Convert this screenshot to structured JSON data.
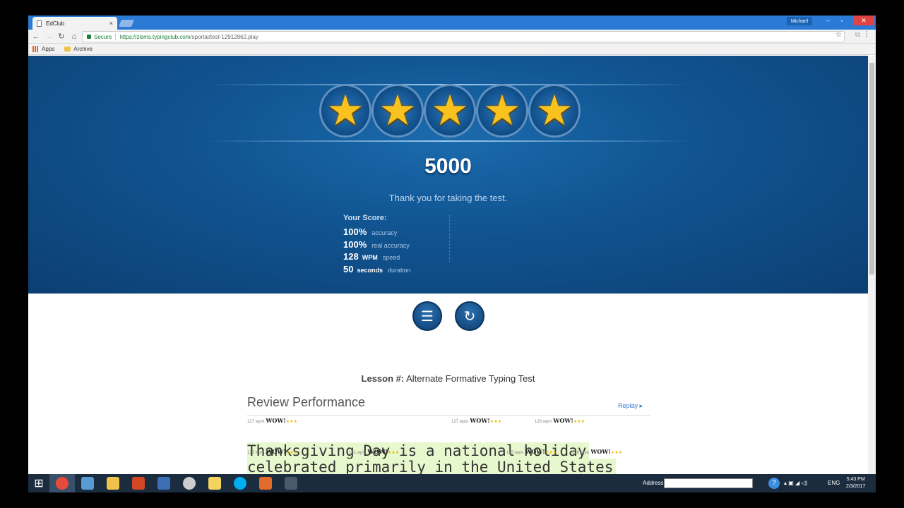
{
  "browser": {
    "tab_title": "EdClub",
    "tab_close": "×",
    "profile_name": "Michael",
    "win_minimize": "–",
    "win_maximize": "▫",
    "win_close": "✕",
    "secure_label": "Secure",
    "url_host": "https://zisms.typingclub.com",
    "url_path": "/sportal/test-12912862.play",
    "bookmarks": [
      "Apps",
      "Archive"
    ]
  },
  "result": {
    "stars_earned": 5,
    "stars_total": 5,
    "points": "5000",
    "thanks": "Thank you for taking the test.",
    "your_score_label": "Your Score:",
    "stats": [
      {
        "value": "100%",
        "unit": "",
        "label": "accuracy"
      },
      {
        "value": "100%",
        "unit": "",
        "label": "real accuracy"
      },
      {
        "value": "128",
        "unit": "WPM",
        "label": "speed"
      },
      {
        "value": "50",
        "unit": "seconds",
        "label": "duration"
      }
    ]
  },
  "actions": {
    "list_icon": "☰",
    "replay_icon": "↻"
  },
  "lesson": {
    "prefix": "Lesson #:",
    "name": "Alternate Formative Typing Test"
  },
  "review": {
    "heading": "Review Performance",
    "replay_label": "Replay ▸",
    "lines": [
      "Thanksgiving Day is a national holiday",
      "celebrated primarily in the United States"
    ],
    "badges_line1": [
      {
        "wpm": "127",
        "unit": "wpm",
        "word": "WOW!",
        "stars": "★★★"
      },
      {
        "wpm": "127",
        "unit": "wpm",
        "word": "WOW!",
        "stars": "★★★"
      },
      {
        "wpm": "128",
        "unit": "wpm",
        "word": "WOW!",
        "stars": "★★★"
      }
    ],
    "badges_line2": [
      {
        "wpm": "128",
        "unit": "wpm",
        "word": "WOW!",
        "stars": "★★★"
      },
      {
        "wpm": "131",
        "unit": "wpm",
        "word": "WOW!",
        "stars": "★★★"
      },
      {
        "wpm": "125",
        "unit": "wpm",
        "word": "WOW!",
        "stars": "★★★"
      },
      {
        "wpm": "128",
        "unit": "wpm",
        "word": "WOW!",
        "stars": "★★★"
      }
    ]
  },
  "taskbar": {
    "address_label": "Address",
    "language": "ENG",
    "time": "5:43 PM",
    "date": "2/3/2017",
    "colors": {
      "chrome": "#e84a3a",
      "explorer": "#5b9bd5",
      "files": "#f0c24b",
      "powerpoint": "#d24726",
      "vbox": "#3c6fb4",
      "apple": "#cccccc",
      "folder": "#f4d35e",
      "skype": "#00aff0",
      "flame": "#e26a2c",
      "app": "#4a5a6a"
    }
  }
}
